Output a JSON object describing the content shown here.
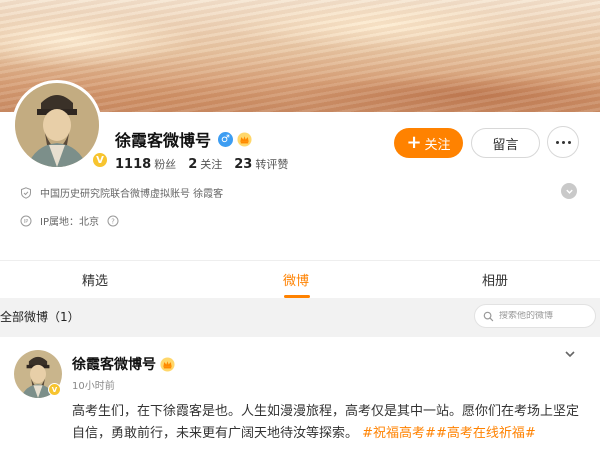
{
  "profile": {
    "name": "徐霞客微博号",
    "verified_badge": "V",
    "gender_icon": "♂",
    "followers_count": "1118",
    "followers_label": "粉丝",
    "following_count": "2",
    "following_label": "关注",
    "reposts_count": "23",
    "reposts_label": "转评赞",
    "follow_button": "关注",
    "message_button": "留言",
    "description": "中国历史研究院联合微博虚拟账号 徐霞客",
    "ip_location": "IP属地：北京"
  },
  "tabs": [
    {
      "label": "精选",
      "active": false
    },
    {
      "label": "微博",
      "active": true
    },
    {
      "label": "相册",
      "active": false
    }
  ],
  "feed": {
    "title": "全部微博（1）",
    "search_placeholder": "搜索他的微博"
  },
  "post": {
    "author": "徐霞客微博号",
    "time": "10小时前",
    "text": "高考生们，在下徐霞客是也。人生如漫漫旅程，高考仅是其中一站。愿你们在考场上坚定自信，勇敢前行，未来更有广阔天地待汝等探索。",
    "hashtags": [
      "#祝福高考#",
      "#高考在线祈福#"
    ]
  },
  "colors": {
    "accent": "#ff8200",
    "verified_gold": "#f7c42f",
    "gender_blue": "#3d9df2"
  }
}
